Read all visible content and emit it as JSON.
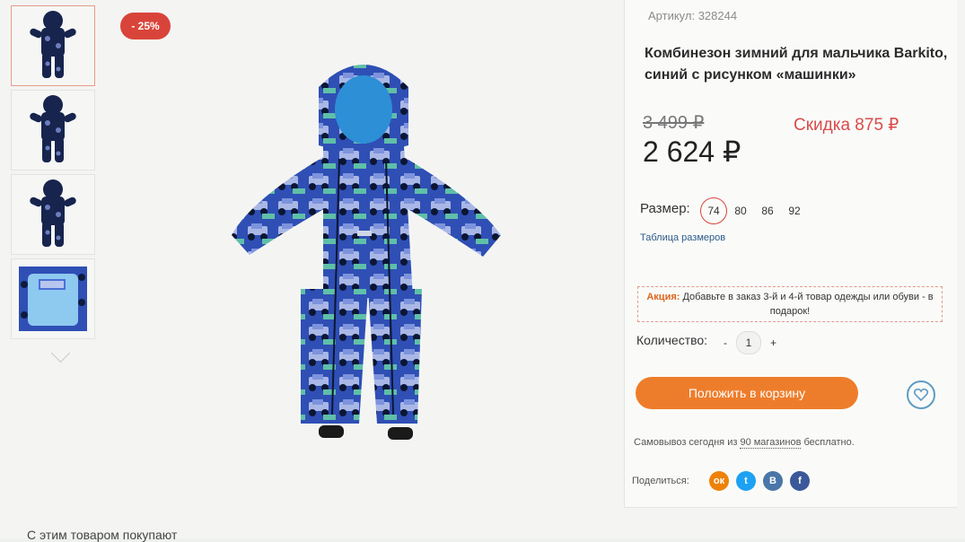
{
  "badge": {
    "discount": "- 25%"
  },
  "product": {
    "article": "Артикул: 328244",
    "title": "Комбинезон зимний для мальчика Barkito, синий с рисунком «машинки»",
    "old_price": "3 499 ₽",
    "discount_text": "Скидка 875 ₽",
    "price": "2 624 ₽"
  },
  "size": {
    "label": "Размер:",
    "options": [
      "74",
      "80",
      "86",
      "92"
    ],
    "selected": "74",
    "table_link": "Таблица размеров"
  },
  "promo": {
    "label": "Акция:",
    "text": "Добавьте в заказ 3-й и 4-й товар одежды или обуви - в подарок!"
  },
  "quantity": {
    "label": "Количество:",
    "minus": "-",
    "value": "1",
    "plus": "+"
  },
  "cart_button": "Положить в корзину",
  "pickup": {
    "prefix": "Самовывоз сегодня из ",
    "link": "90 магазинов",
    "suffix": " бесплатно."
  },
  "share": {
    "label": "Поделиться:",
    "networks": [
      {
        "name": "odnoklassniki-icon",
        "glyph": "ок",
        "color": "#ee8208"
      },
      {
        "name": "twitter-icon",
        "glyph": "t",
        "color": "#1da1f2"
      },
      {
        "name": "vk-icon",
        "glyph": "В",
        "color": "#4a76a8"
      },
      {
        "name": "facebook-icon",
        "glyph": "f",
        "color": "#3b5998"
      }
    ]
  },
  "colors": {
    "accent": "#ee7d2b",
    "sale": "#d9443a",
    "link": "#2e5a8a"
  },
  "footer": {
    "partial_text": "С этим товаром покупают"
  }
}
